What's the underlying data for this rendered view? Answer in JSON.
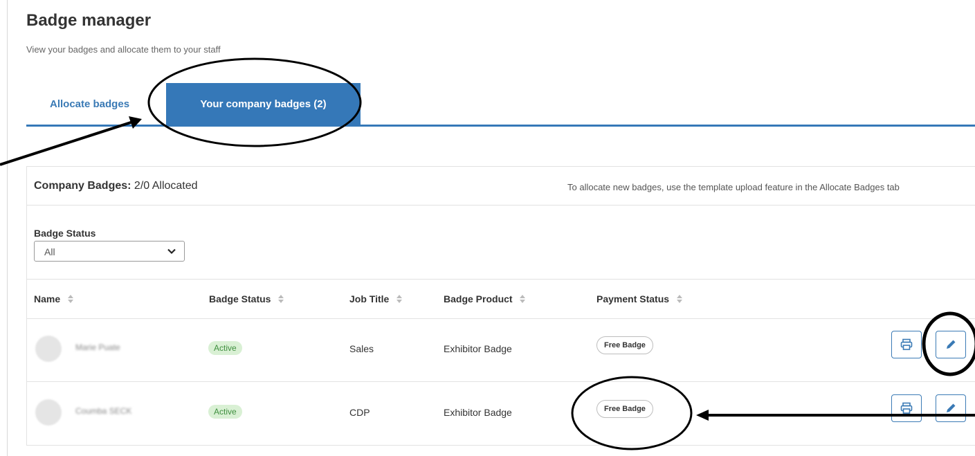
{
  "page": {
    "title": "Badge manager",
    "subtitle": "View your badges and allocate them to your staff"
  },
  "tabs": [
    {
      "label": "Allocate badges",
      "active": false
    },
    {
      "label": "Your company badges (2)",
      "active": true
    }
  ],
  "panel": {
    "summary_label": "Company Badges:",
    "summary_value": "2/0 Allocated",
    "note": "To allocate new badges, use the template upload feature in the Allocate Badges tab",
    "filter_label": "Badge Status",
    "filter_value": "All"
  },
  "table": {
    "columns": [
      "Name",
      "Badge Status",
      "Job Title",
      "Badge Product",
      "Payment Status"
    ],
    "rows": [
      {
        "name": "Marie Puate",
        "status": "Active",
        "job_title": "Sales",
        "product": "Exhibitor Badge",
        "payment": "Free Badge"
      },
      {
        "name": "Coumba SECK",
        "status": "Active",
        "job_title": "CDP",
        "product": "Exhibitor Badge",
        "payment": "Free Badge"
      }
    ]
  },
  "icons": {
    "print": "printer-icon",
    "edit": "pencil-icon",
    "sort": "sort-icon",
    "dropdown": "chevron-down-icon"
  },
  "colors": {
    "accent": "#3578b8",
    "active_bg": "#d9f0d4",
    "active_text": "#3f8f3f"
  }
}
